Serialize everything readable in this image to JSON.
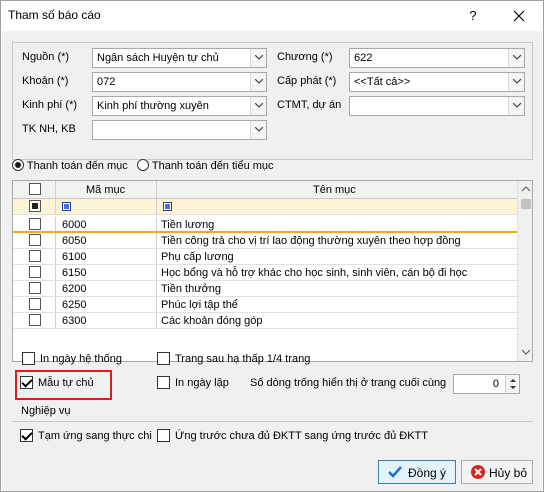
{
  "window": {
    "title": "Tham số báo cáo",
    "help_glyph": "?",
    "close_icon": "close-icon"
  },
  "params": {
    "nguon": {
      "label": "Nguồn (*)",
      "value": "Ngân sách Huyện tự chủ"
    },
    "khoan": {
      "label": "Khoản (*)",
      "value": "072"
    },
    "kinh_phi": {
      "label": "Kinh phí (*)",
      "value": "Kinh phí thường xuyên"
    },
    "tk_nh": {
      "label": "TK NH, KB",
      "value": ""
    },
    "chuong": {
      "label": "Chương (*)",
      "value": "622"
    },
    "cap_phat": {
      "label": "Cấp phát (*)",
      "value": "<<Tất cả>>"
    },
    "ctmt": {
      "label": "CTMT, dự án",
      "value": ""
    }
  },
  "radios": [
    {
      "label": "Thanh toán đến mục",
      "selected": true
    },
    {
      "label": "Thanh toán đến tiểu mục",
      "selected": false
    }
  ],
  "grid": {
    "headers": {
      "code": "Mã mục",
      "name": "Tên mục"
    },
    "rows": [
      {
        "code": "6000",
        "name": "Tiền lương",
        "selected": true
      },
      {
        "code": "6050",
        "name": "Tiền công trả cho vị trí lao động thường xuyên theo hợp đồng",
        "selected": false
      },
      {
        "code": "6100",
        "name": "Phụ cấp lương",
        "selected": false
      },
      {
        "code": "6150",
        "name": "Học bổng và hỗ trợ khác cho học sinh, sinh viên, cán bộ đi học",
        "selected": false
      },
      {
        "code": "6200",
        "name": "Tiền thưởng",
        "selected": false
      },
      {
        "code": "6250",
        "name": "Phúc lợi tập thể",
        "selected": false
      },
      {
        "code": "6300",
        "name": "Các khoản đóng góp",
        "selected": false
      }
    ],
    "selected_row_color": "#f5a623"
  },
  "options": {
    "in_ngay_he_thong": {
      "label": "In ngày hệ thống",
      "checked": false
    },
    "trang_sau": {
      "label": "Trang sau hạ thấp 1/4 trang",
      "checked": false
    },
    "mau_tu_chu": {
      "label": "Mẫu tự chủ",
      "checked": true
    },
    "in_ngay_lap": {
      "label": "In ngày lập",
      "checked": false
    },
    "so_dong_label": "Số dòng trống hiển thị ở trang cuối cùng",
    "so_dong_value": "0"
  },
  "nghiep_vu": {
    "title": "Nghiệp vụ",
    "tam_ung": {
      "label": "Tạm ứng sang thực chi",
      "checked": true
    },
    "ung_truoc": {
      "label": "Ứng trước chưa đủ ĐKTT sang ứng trước đủ ĐKTT",
      "checked": false
    }
  },
  "buttons": {
    "ok": "Đồng ý",
    "cancel": "Hủy bỏ"
  },
  "colors": {
    "highlight_border": "#e01b1b",
    "ok_icon": "#1f6fd1",
    "cancel_icon": "#d9261c"
  }
}
